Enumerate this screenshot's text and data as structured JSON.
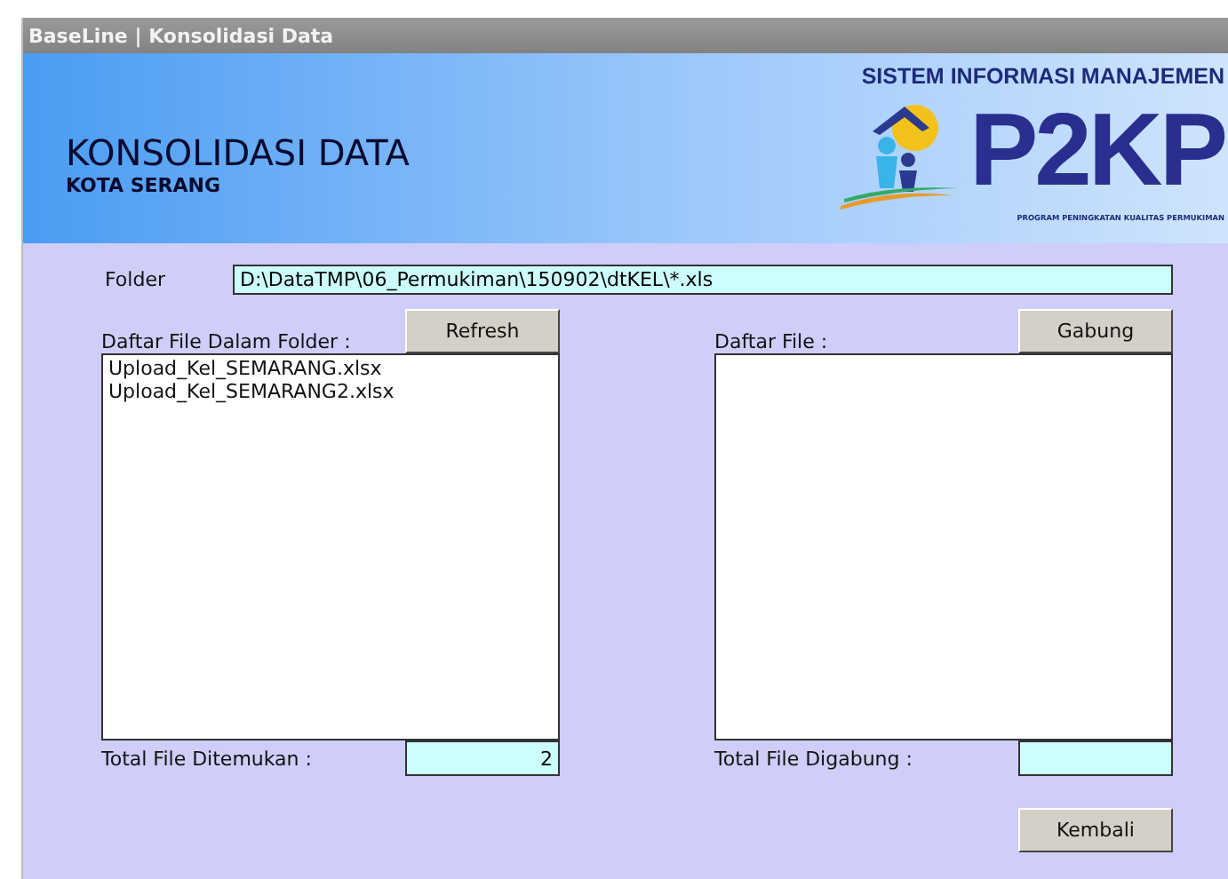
{
  "window": {
    "title": "BaseLine | Konsolidasi Data"
  },
  "header": {
    "title": "KONSOLIDASI DATA",
    "subtitle": "KOTA SERANG",
    "logo_tagline": "SISTEM INFORMASI MANAJEMEN",
    "logo_text": "P2KP",
    "logo_caption": "PROGRAM PENINGKATAN KUALITAS PERMUKIMAN"
  },
  "folder": {
    "label": "Folder",
    "value": "D:\\DataTMP\\06_Permukiman\\150902\\dtKEL\\*.xls"
  },
  "left_panel": {
    "label": "Daftar File Dalam Folder :",
    "button": "Refresh",
    "files": [
      "Upload_Kel_SEMARANG.xlsx",
      "Upload_Kel_SEMARANG2.xlsx"
    ],
    "total_label": "Total File Ditemukan :",
    "total_value": "2"
  },
  "right_panel": {
    "label": "Daftar File :",
    "button": "Gabung",
    "total_label": "Total File Digabung :"
  },
  "buttons": [
    "Kembali"
  ]
}
